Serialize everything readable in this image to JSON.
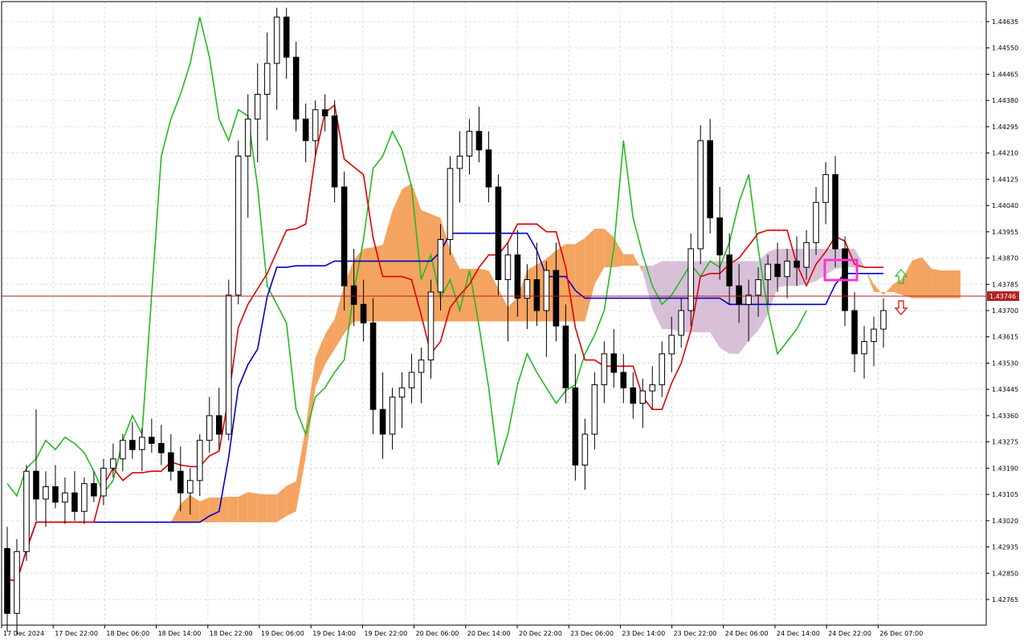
{
  "chart_data": {
    "type": "candlestick",
    "title": "",
    "xlabel": "",
    "ylabel": "",
    "ylim": [
      1.427,
      1.447
    ],
    "grid": true,
    "y_ticks": [
      "1.44635",
      "1.44550",
      "1.44465",
      "1.44380",
      "1.44295",
      "1.44210",
      "1.44125",
      "1.44040",
      "1.43955",
      "1.43870",
      "1.43785",
      "1.43700",
      "1.43615",
      "1.43530",
      "1.43445",
      "1.43360",
      "1.43275",
      "1.43190",
      "1.43105",
      "1.43020",
      "1.42935",
      "1.42850",
      "1.42765"
    ],
    "x_labels": [
      "17 Dec 2024",
      "17 Dec 22:00",
      "18 Dec 06:00",
      "18 Dec 14:00",
      "18 Dec 22:00",
      "19 Dec 06:00",
      "19 Dec 14:00",
      "19 Dec 22:00",
      "20 Dec 06:00",
      "20 Dec 14:00",
      "20 Dec 22:00",
      "23 Dec 06:00",
      "23 Dec 14:00",
      "23 Dec 22:00",
      "24 Dec 06:00",
      "24 Dec 14:00",
      "24 Dec 22:00",
      "26 Dec 07:00"
    ],
    "current_price": "1.43746",
    "colors": {
      "bull_candle": "#ffffff",
      "bear_candle": "#000000",
      "tenkan": "#e00000",
      "kijun": "#0000cc",
      "chikou": "#22bb22",
      "kumo_bull": "#f4a460",
      "kumo_bear": "#d8bfd8",
      "price_line": "#b22222",
      "highlight_box": "#ff33cc",
      "arrow_up": "#22bb22",
      "arrow_down": "#e00000"
    },
    "candles": [
      [
        1.4293,
        1.43,
        1.4266,
        1.4272
      ],
      [
        1.4272,
        1.4296,
        1.4265,
        1.4292
      ],
      [
        1.4292,
        1.432,
        1.4289,
        1.4318
      ],
      [
        1.4318,
        1.4338,
        1.4302,
        1.4309
      ],
      [
        1.4309,
        1.4318,
        1.43,
        1.4313
      ],
      [
        1.4313,
        1.432,
        1.4306,
        1.4308
      ],
      [
        1.4308,
        1.4316,
        1.4301,
        1.4311
      ],
      [
        1.4311,
        1.4318,
        1.4302,
        1.4305
      ],
      [
        1.4305,
        1.4316,
        1.4301,
        1.4314
      ],
      [
        1.4314,
        1.4318,
        1.4308,
        1.431
      ],
      [
        1.431,
        1.4322,
        1.4307,
        1.4319
      ],
      [
        1.4319,
        1.4327,
        1.4316,
        1.4322
      ],
      [
        1.4322,
        1.433,
        1.4318,
        1.4328
      ],
      [
        1.4328,
        1.4334,
        1.4322,
        1.4325
      ],
      [
        1.4325,
        1.4332,
        1.4318,
        1.4329
      ],
      [
        1.4329,
        1.4335,
        1.4324,
        1.4327
      ],
      [
        1.4327,
        1.4333,
        1.432,
        1.4324
      ],
      [
        1.4324,
        1.433,
        1.4315,
        1.4318
      ],
      [
        1.4318,
        1.4326,
        1.4305,
        1.4311
      ],
      [
        1.4311,
        1.4319,
        1.4304,
        1.4315
      ],
      [
        1.4315,
        1.433,
        1.431,
        1.4328
      ],
      [
        1.4328,
        1.4342,
        1.4324,
        1.4336
      ],
      [
        1.4336,
        1.4345,
        1.4325,
        1.433
      ],
      [
        1.433,
        1.438,
        1.4328,
        1.4375
      ],
      [
        1.4375,
        1.4425,
        1.4372,
        1.442
      ],
      [
        1.442,
        1.444,
        1.44,
        1.4432
      ],
      [
        1.4432,
        1.445,
        1.4418,
        1.444
      ],
      [
        1.444,
        1.446,
        1.4425,
        1.445
      ],
      [
        1.445,
        1.4468,
        1.4435,
        1.4465
      ],
      [
        1.4465,
        1.4468,
        1.4445,
        1.4452
      ],
      [
        1.4452,
        1.4457,
        1.4428,
        1.4432
      ],
      [
        1.4432,
        1.4437,
        1.4418,
        1.4425
      ],
      [
        1.4425,
        1.4438,
        1.442,
        1.4435
      ],
      [
        1.4435,
        1.444,
        1.4428,
        1.4433
      ],
      [
        1.4433,
        1.4438,
        1.4405,
        1.441
      ],
      [
        1.441,
        1.4415,
        1.437,
        1.4378
      ],
      [
        1.4378,
        1.439,
        1.4365,
        1.4372
      ],
      [
        1.4372,
        1.438,
        1.436,
        1.4366
      ],
      [
        1.4366,
        1.4374,
        1.433,
        1.4338
      ],
      [
        1.4338,
        1.435,
        1.4322,
        1.433
      ],
      [
        1.433,
        1.4345,
        1.4325,
        1.4342
      ],
      [
        1.4342,
        1.435,
        1.4332,
        1.4345
      ],
      [
        1.4345,
        1.4356,
        1.434,
        1.435
      ],
      [
        1.435,
        1.4358,
        1.434,
        1.4354
      ],
      [
        1.4354,
        1.438,
        1.4348,
        1.4376
      ],
      [
        1.4376,
        1.4398,
        1.437,
        1.4393
      ],
      [
        1.4393,
        1.442,
        1.4388,
        1.4416
      ],
      [
        1.4416,
        1.4428,
        1.4405,
        1.442
      ],
      [
        1.442,
        1.4432,
        1.4414,
        1.4428
      ],
      [
        1.4428,
        1.4436,
        1.4418,
        1.4422
      ],
      [
        1.4422,
        1.4428,
        1.4405,
        1.441
      ],
      [
        1.441,
        1.4414,
        1.4375,
        1.438
      ],
      [
        1.438,
        1.4392,
        1.436,
        1.4388
      ],
      [
        1.4388,
        1.4396,
        1.4368,
        1.4374
      ],
      [
        1.4374,
        1.4385,
        1.4364,
        1.438
      ],
      [
        1.438,
        1.4392,
        1.4365,
        1.437
      ],
      [
        1.437,
        1.4386,
        1.4355,
        1.4383
      ],
      [
        1.4383,
        1.4392,
        1.436,
        1.4365
      ],
      [
        1.4365,
        1.4372,
        1.434,
        1.4345
      ],
      [
        1.4345,
        1.4356,
        1.4315,
        1.432
      ],
      [
        1.432,
        1.4335,
        1.4312,
        1.433
      ],
      [
        1.433,
        1.435,
        1.4325,
        1.4346
      ],
      [
        1.4346,
        1.436,
        1.434,
        1.4356
      ],
      [
        1.4356,
        1.4364,
        1.4345,
        1.435
      ],
      [
        1.435,
        1.4356,
        1.434,
        1.4345
      ],
      [
        1.4345,
        1.435,
        1.4335,
        1.434
      ],
      [
        1.434,
        1.4348,
        1.4332,
        1.4344
      ],
      [
        1.4344,
        1.4352,
        1.4338,
        1.4346
      ],
      [
        1.4346,
        1.436,
        1.4342,
        1.4356
      ],
      [
        1.4356,
        1.4368,
        1.435,
        1.4362
      ],
      [
        1.4362,
        1.4374,
        1.4358,
        1.437
      ],
      [
        1.437,
        1.4395,
        1.4365,
        1.439
      ],
      [
        1.439,
        1.443,
        1.4385,
        1.4425
      ],
      [
        1.4425,
        1.4432,
        1.4395,
        1.44
      ],
      [
        1.44,
        1.441,
        1.438,
        1.4388
      ],
      [
        1.4388,
        1.4395,
        1.4372,
        1.4378
      ],
      [
        1.4378,
        1.4385,
        1.4366,
        1.4372
      ],
      [
        1.4372,
        1.438,
        1.436,
        1.4375
      ],
      [
        1.4375,
        1.4384,
        1.4368,
        1.438
      ],
      [
        1.438,
        1.4388,
        1.4372,
        1.4385
      ],
      [
        1.4385,
        1.4392,
        1.4376,
        1.4381
      ],
      [
        1.4381,
        1.439,
        1.4374,
        1.4386
      ],
      [
        1.4386,
        1.4394,
        1.4378,
        1.4384
      ],
      [
        1.4384,
        1.4396,
        1.438,
        1.4392
      ],
      [
        1.4392,
        1.441,
        1.4388,
        1.4405
      ],
      [
        1.4405,
        1.4418,
        1.4398,
        1.4414
      ],
      [
        1.4414,
        1.442,
        1.4384,
        1.439
      ],
      [
        1.439,
        1.4394,
        1.4365,
        1.437
      ],
      [
        1.437,
        1.4376,
        1.435,
        1.4356
      ],
      [
        1.4356,
        1.4365,
        1.4348,
        1.436
      ],
      [
        1.436,
        1.4368,
        1.4352,
        1.4364
      ],
      [
        1.4364,
        1.4374,
        1.4358,
        1.437
      ]
    ]
  }
}
